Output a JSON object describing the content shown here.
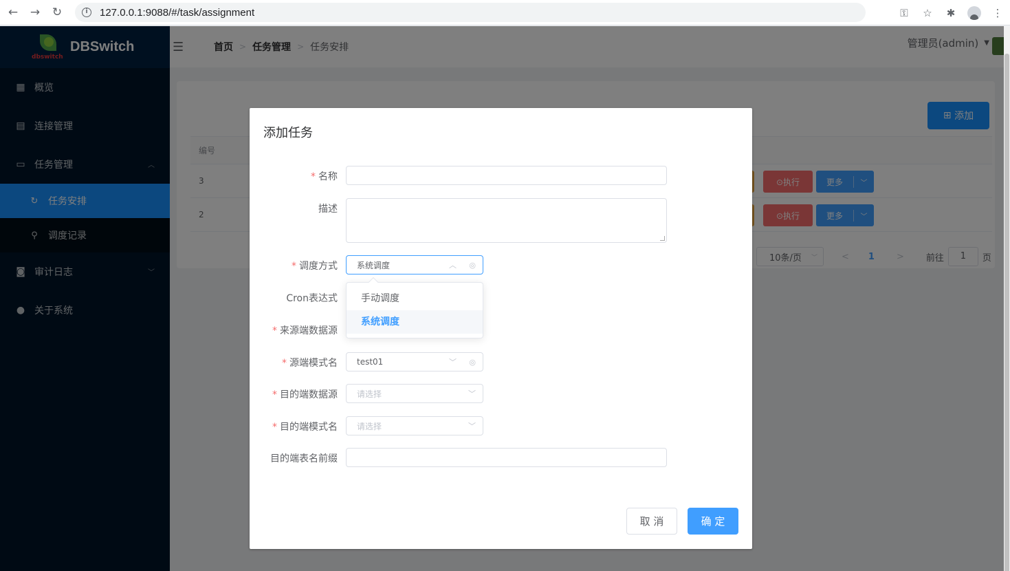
{
  "browser": {
    "url": "127.0.0.1:9088/#/task/assignment"
  },
  "sidebar": {
    "logo_title": "DBSwitch",
    "logo_sub": "dbswitch",
    "items": [
      {
        "label": "概览",
        "icon": "grid-icon"
      },
      {
        "label": "连接管理",
        "icon": "clipboard-icon"
      },
      {
        "label": "任务管理",
        "icon": "folder-icon"
      },
      {
        "label": "审计日志",
        "icon": "log-icon"
      },
      {
        "label": "关于系统",
        "icon": "user-icon"
      }
    ],
    "sub_items": [
      {
        "label": "任务安排",
        "icon": "refresh-icon",
        "active": true
      },
      {
        "label": "调度记录",
        "icon": "person-icon",
        "active": false
      }
    ]
  },
  "header": {
    "breadcrumb": [
      "首页",
      "任务管理",
      "任务安排"
    ],
    "user": "管理员(admin)"
  },
  "main": {
    "add_label": "添加",
    "table": {
      "header": "编号",
      "rows": [
        {
          "id": "3",
          "run_label": "⊙执行",
          "more_label": "更多"
        },
        {
          "id": "2",
          "run_label": "⊙执行",
          "more_label": "更多"
        }
      ]
    },
    "pager": {
      "page_size": "10条/页",
      "current": "1",
      "goto_label": "前往",
      "goto_value": "1",
      "unit": "页"
    }
  },
  "dialog": {
    "title": "添加任务",
    "fields": {
      "name_label": "名称",
      "desc_label": "描述",
      "schedule_label": "调度方式",
      "schedule_value": "系统调度",
      "cron_label": "Cron表达式",
      "source_ds_label": "来源端数据源",
      "source_schema_label": "源端模式名",
      "source_schema_value": "test01",
      "target_ds_label": "目的端数据源",
      "target_ds_placeholder": "请选择",
      "target_schema_label": "目的端模式名",
      "target_schema_placeholder": "请选择",
      "prefix_label": "目的端表名前缀"
    },
    "dropdown_options": [
      "手动调度",
      "系统调度"
    ],
    "cancel_label": "取 消",
    "ok_label": "确 定"
  }
}
